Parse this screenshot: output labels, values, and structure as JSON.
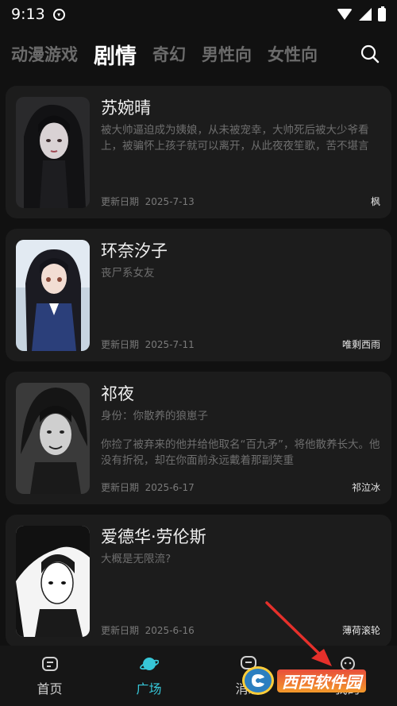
{
  "status_bar": {
    "time": "9:13"
  },
  "tabs": [
    {
      "label": "动漫游戏",
      "active": false
    },
    {
      "label": "剧情",
      "active": true
    },
    {
      "label": "奇幻",
      "active": false
    },
    {
      "label": "男性向",
      "active": false
    },
    {
      "label": "女性向",
      "active": false
    }
  ],
  "cards": [
    {
      "title": "苏婉晴",
      "desc": "被大帅逼迫成为姨娘，从未被宠幸，大帅死后被大少爷看上，被骗怀上孩子就可以离开，从此夜夜笙歌，苦不堪言",
      "desc2": "",
      "date_label": "更新日期",
      "date": "2025-7-13",
      "author": "枫"
    },
    {
      "title": "环奈汐子",
      "desc": "丧尸系女友",
      "desc2": "",
      "date_label": "更新日期",
      "date": "2025-7-11",
      "author": "唯剩西雨"
    },
    {
      "title": "祁夜",
      "desc": "身份：你散养的狼崽子",
      "desc2": "你捡了被弃来的他并给他取名“百九矛”，将他散养长大。他没有折祝，却在你面前永远戴着那副笑重",
      "date_label": "更新日期",
      "date": "2025-6-17",
      "author": "祁泣冰"
    },
    {
      "title": "爱德华·劳伦斯",
      "desc": "大概是无限流?",
      "desc2": "",
      "date_label": "更新日期",
      "date": "2025-6-16",
      "author": "薄荷滚轮"
    }
  ],
  "bottom_nav": [
    {
      "label": "首页",
      "icon": "home-icon",
      "active": false
    },
    {
      "label": "广场",
      "icon": "planet-icon",
      "active": true
    },
    {
      "label": "消息",
      "icon": "message-icon",
      "active": false
    },
    {
      "label": "我的",
      "icon": "profile-icon",
      "active": false
    }
  ],
  "watermark": {
    "text": "西西软件园"
  },
  "colors": {
    "accent": "#37c7d8",
    "background": "#111111",
    "card": "#1c1c1c",
    "arrow": "#e5302b"
  }
}
